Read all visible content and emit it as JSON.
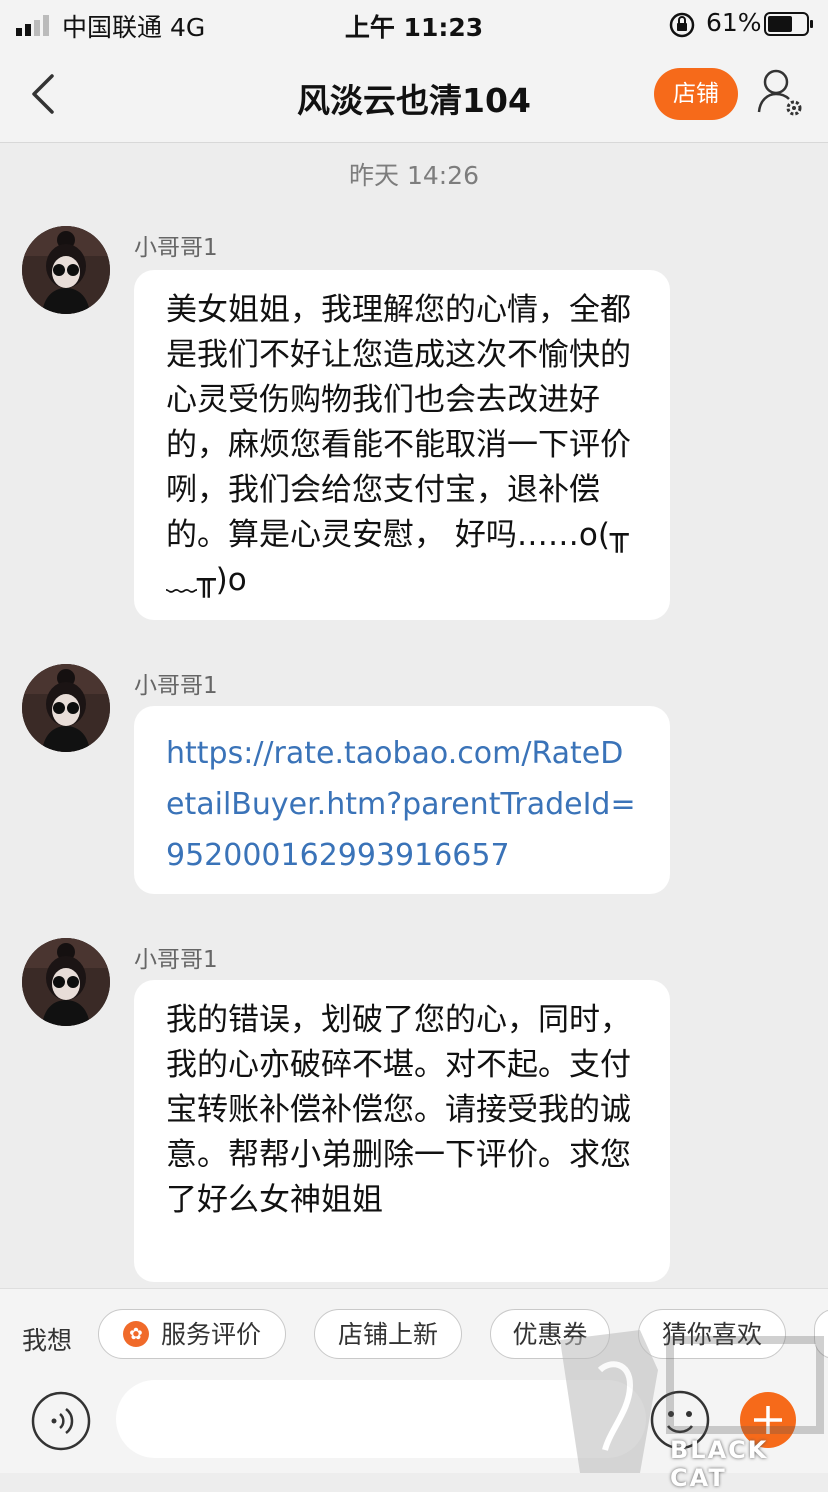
{
  "status_bar": {
    "carrier": "中国联通  4G",
    "time": "上午 11:23",
    "battery": "61%"
  },
  "header": {
    "title": "风淡云也清104",
    "shop_label": "店铺",
    "back_icon": "back-chevron-icon",
    "user_icon": "user-settings-icon"
  },
  "timestamp": "昨天 14:26",
  "messages": [
    {
      "sender": "小哥哥1",
      "text": "美女姐姐，我理解您的心情，全都是我们不好让您造成这次不愉快的心灵受伤购物我们也会去改进好的，麻烦您看能不能取消一下评价咧，我们会给您支付宝，退补偿的。算是心灵安慰， 好吗……o(╥﹏╥)o",
      "type": "text"
    },
    {
      "sender": "小哥哥1",
      "text": "https://rate.taobao.com/RateDetailBuyer.htm?parentTradeId=952000162993916657",
      "type": "link"
    },
    {
      "sender": "小哥哥1",
      "text": "我的错误，划破了您的心，同时，我的心亦破碎不堪。对不起。支付宝转账补偿补偿您。请接受我的诚意。帮帮小弟删除一下评价。求您了好么女神姐姐",
      "type": "text"
    }
  ],
  "quick_bar": {
    "label": "我想",
    "chips": [
      "服务评价",
      "店铺上新",
      "优惠券",
      "猜你喜欢"
    ]
  },
  "watermark": {
    "text": "BLACK CAT"
  },
  "colors": {
    "accent": "#f66a1a",
    "link": "#3a73b8",
    "background": "#ededed"
  }
}
